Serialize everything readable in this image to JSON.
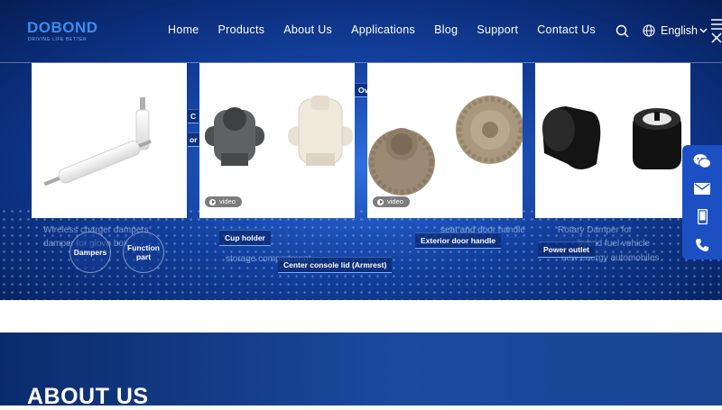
{
  "brand": {
    "name": "DOBOND",
    "tagline": "DRIVING LIFE BETTER",
    "color": "#3c8cf0"
  },
  "nav": {
    "items": [
      "Home",
      "Products",
      "About Us",
      "Applications",
      "Blog",
      "Support",
      "Contact Us"
    ]
  },
  "header": {
    "language": "English"
  },
  "products": [
    {
      "has_video": false
    },
    {
      "has_video": true,
      "video_label": "video"
    },
    {
      "has_video": true,
      "video_label": "video"
    },
    {
      "has_video": false
    }
  ],
  "hero_labels": {
    "dampers": "Dampers",
    "function_part": "Function part",
    "cup_holder": "Cup holder",
    "center_console": "Center console lid (Armrest)",
    "exterior_handle": "Exterior door handle",
    "power_outlet": "Power outlet",
    "partial_top_left": "Ov",
    "partial_door": "or ha",
    "partial_c": "C"
  },
  "hero_background_text": [
    "Wireless charger dampers",
    "damper for glove box",
    "storage compartment",
    "seat and door handle",
    "Rotary Damper for",
    "hybrid fuel vehicle",
    "new energy automobiles"
  ],
  "side_contacts": [
    "wechat-icon",
    "email-icon",
    "mobile-icon",
    "phone-icon"
  ],
  "about": {
    "heading": "ABOUT US"
  }
}
